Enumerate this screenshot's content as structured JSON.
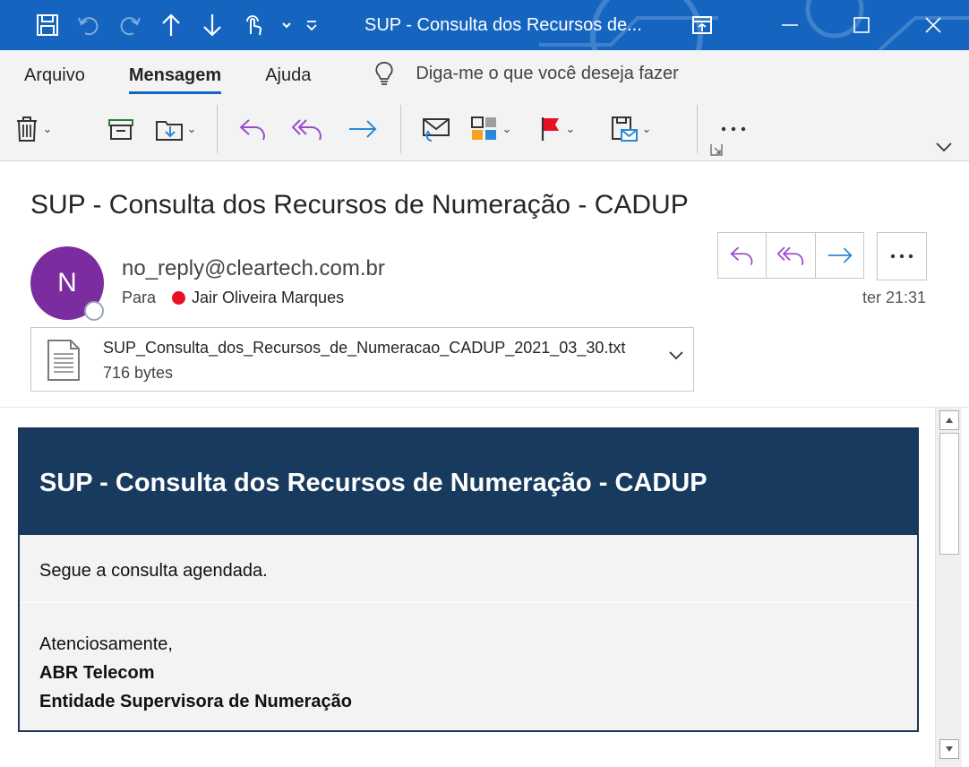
{
  "window": {
    "title": "SUP - Consulta dos Recursos de..."
  },
  "ribbon": {
    "tabs": [
      {
        "label": "Arquivo",
        "active": false
      },
      {
        "label": "Mensagem",
        "active": true
      },
      {
        "label": "Ajuda",
        "active": false
      }
    ],
    "tell_me_placeholder": "Diga-me o que você deseja fazer"
  },
  "message": {
    "subject": "SUP - Consulta dos Recursos de Numeração - CADUP",
    "avatar_initial": "N",
    "sender": "no_reply@cleartech.com.br",
    "to_label": "Para",
    "recipient": "Jair Oliveira Marques",
    "time": "ter 21:31",
    "attachment": {
      "name": "SUP_Consulta_dos_Recursos_de_Numeracao_CADUP_2021_03_30.txt",
      "size": "716 bytes"
    }
  },
  "body": {
    "banner_title": "SUP - Consulta dos Recursos de Numeração - CADUP",
    "line1": "Segue a consulta agendada.",
    "closing": "Atenciosamente,",
    "org": "ABR Telecom",
    "org_sub": "Entidade Supervisora de Numeração"
  },
  "colors": {
    "titlebar": "#1565c0",
    "avatar": "#7b2c9e",
    "banner": "#173a5e",
    "reply_purple": "#9b4dca",
    "forward_blue": "#2b88d8",
    "presence_busy": "#e81123"
  },
  "icons": {
    "qat": [
      "save-icon",
      "undo-icon",
      "redo-icon",
      "up-arrow-icon",
      "down-arrow-icon",
      "touch-mode-icon",
      "customize-qat-icon"
    ],
    "window": [
      "ribbon-display-icon",
      "minimize-icon",
      "maximize-icon",
      "close-icon"
    ],
    "toolbar": [
      "delete-icon",
      "archive-icon",
      "move-icon",
      "reply-icon",
      "reply-all-icon",
      "forward-icon",
      "respond-icon",
      "categorize-icon",
      "flag-icon",
      "assign-policy-icon",
      "more-icon"
    ]
  }
}
